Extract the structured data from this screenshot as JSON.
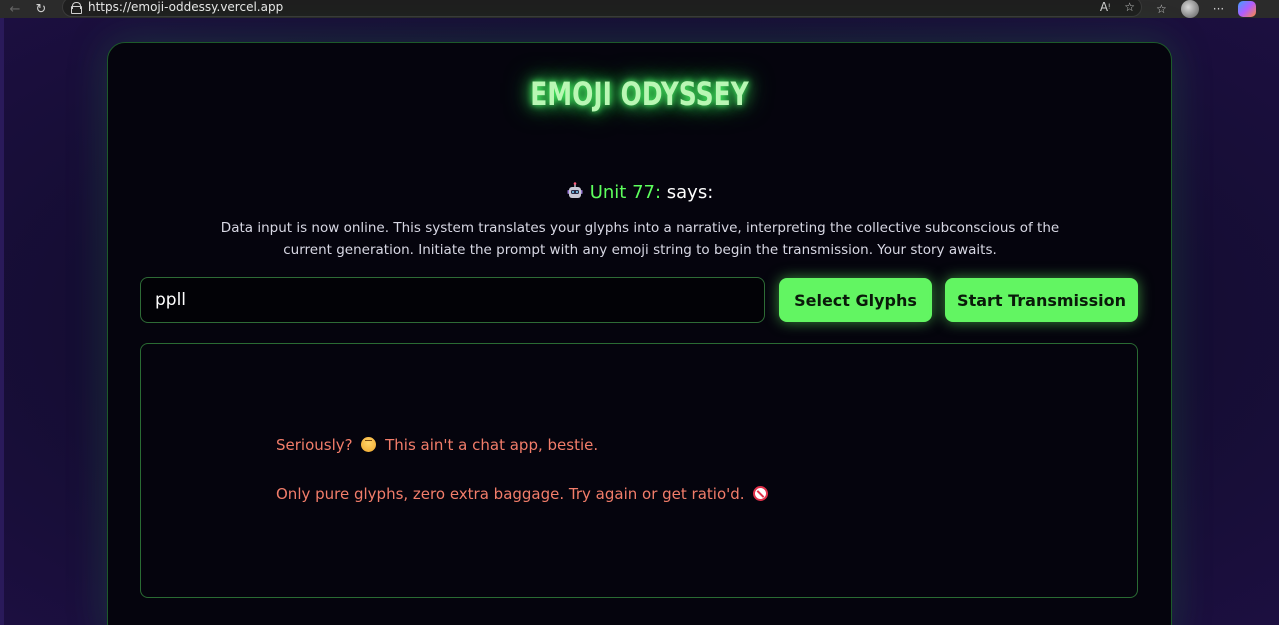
{
  "browser": {
    "url": "https://emoji-oddessy.vercel.app",
    "back_glyph": "←",
    "reload_glyph": "↻",
    "read_aloud_glyph": "Aᵎ",
    "favorite_glyph": "☆",
    "favorites_bar_glyph": "☆",
    "menu_glyph": "···"
  },
  "app": {
    "title": "EMOJI ODYSSEY",
    "speaker_name": "Unit 77:",
    "speaker_verb": " says:",
    "intro": "Data input is now online. This system translates your glyphs into a narrative, interpreting the collective subconscious of the current generation. Initiate the prompt with any emoji string to begin the transmission. Your story awaits.",
    "input_value": "ppll",
    "select_button": "Select Glyphs",
    "start_button": "Start Transmission",
    "error_line1_a": "Seriously? ",
    "error_line1_b": " This ain't a chat app, bestie.",
    "error_line2": "Only pure glyphs, zero extra baggage. Try again or get ratio'd. "
  },
  "icons": {
    "robot": "robot-icon",
    "face": "face-with-rolling-eyes-icon",
    "no_entry": "prohibited-icon"
  },
  "colors": {
    "accent_green": "#62f562",
    "title_glow": "#4cff6a",
    "error_text": "#f27d6a",
    "card_bg": "#05040d"
  }
}
